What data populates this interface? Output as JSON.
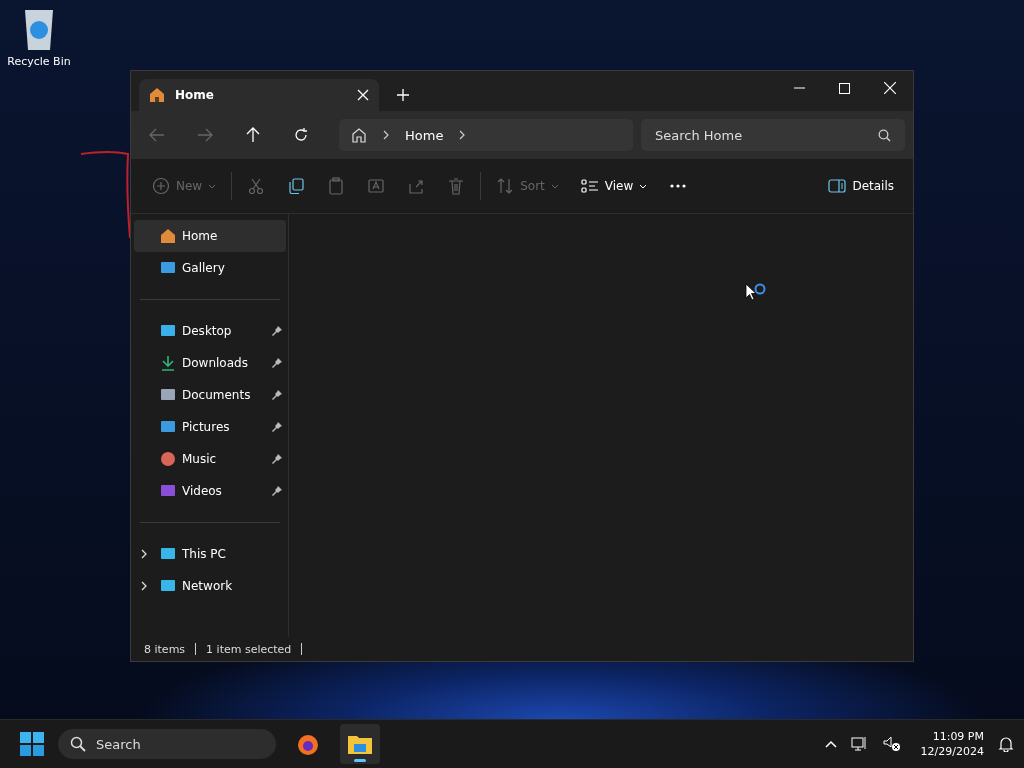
{
  "desktop": {
    "icons": [
      {
        "label": "Recycle Bin"
      }
    ]
  },
  "window": {
    "tabs": [
      {
        "label": "Home",
        "selected": true
      }
    ],
    "nav": [
      {
        "kind": "back",
        "disabled": true
      },
      {
        "kind": "forward",
        "disabled": true
      },
      {
        "kind": "up",
        "disabled": false
      },
      {
        "kind": "refresh",
        "disabled": false
      }
    ],
    "address": {
      "crumbs": [
        "Home"
      ]
    },
    "search": {
      "placeholder": "Search Home"
    },
    "toolbar": [
      {
        "kind": "new",
        "label": "New",
        "disabled": true
      },
      {
        "kind": "cut",
        "disabled": true
      },
      {
        "kind": "copy",
        "disabled": false
      },
      {
        "kind": "paste",
        "disabled": true
      },
      {
        "kind": "rename",
        "disabled": true
      },
      {
        "kind": "share",
        "disabled": true
      },
      {
        "kind": "delete",
        "disabled": true
      },
      {
        "kind": "sort",
        "label": "Sort",
        "disabled": true
      },
      {
        "kind": "view",
        "label": "View",
        "disabled": false
      },
      {
        "kind": "more",
        "disabled": false
      }
    ],
    "details": {
      "label": "Details"
    },
    "sidebar": {
      "groups": [
        [
          {
            "kind": "home",
            "label": "Home",
            "selected": true
          },
          {
            "kind": "gallery",
            "label": "Gallery",
            "selected": false
          }
        ],
        [
          {
            "kind": "desktop",
            "label": "Desktop",
            "selected": false,
            "pinned": true
          },
          {
            "kind": "downloads",
            "label": "Downloads",
            "selected": false,
            "pinned": true
          },
          {
            "kind": "documents",
            "label": "Documents",
            "selected": false,
            "pinned": true
          },
          {
            "kind": "pictures",
            "label": "Pictures",
            "selected": false,
            "pinned": true
          },
          {
            "kind": "music",
            "label": "Music",
            "selected": false,
            "pinned": true
          },
          {
            "kind": "videos",
            "label": "Videos",
            "selected": false,
            "pinned": true
          }
        ],
        [
          {
            "kind": "pc",
            "label": "This PC",
            "selected": false,
            "expanded": false
          },
          {
            "kind": "network",
            "label": "Network",
            "selected": false,
            "expanded": false
          }
        ]
      ]
    },
    "status_bar": {
      "count": "8 items",
      "selection": "1 item selected"
    }
  },
  "taskbar": {
    "search": {
      "placeholder": "Search"
    },
    "apps": [
      {
        "kind": "browser",
        "selected": false
      },
      {
        "kind": "folder",
        "selected": true
      }
    ],
    "clock": {
      "time": "11:09 PM",
      "date": "12/29/2024"
    }
  }
}
